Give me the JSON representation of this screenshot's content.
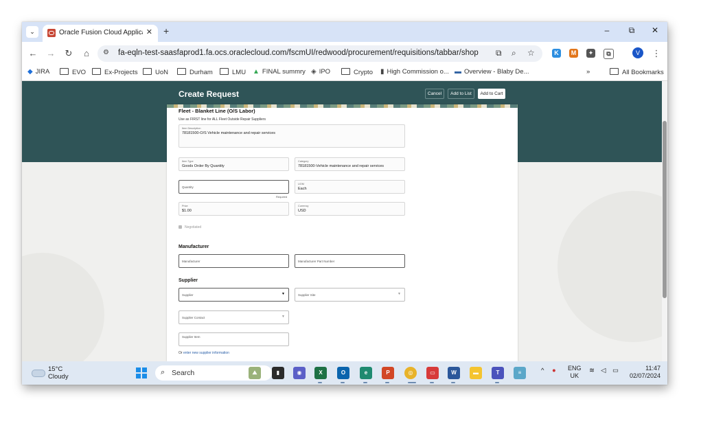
{
  "browser": {
    "tab_title": "Oracle Fusion Cloud Applicatio",
    "url": "fa-eqln-test-saasfaprod1.fa.ocs.oraclecloud.com/fscmUI/redwood/procurement/requisitions/tabbar/shopping/create_...",
    "profile_initial": "V",
    "window_controls": {
      "minimize": "–",
      "restore": "⧉",
      "close": "✕"
    },
    "bookmarks": [
      "JIRA",
      "EVO",
      "Ex-Projects",
      "UoN",
      "Durham",
      "LMU",
      "FINAL summry",
      "IPO",
      "Crypto",
      "High Commission o...",
      "Overview - Blaby De..."
    ],
    "all_bookmarks": "All Bookmarks",
    "more_bookmarks": "»"
  },
  "page": {
    "title": "Create Request",
    "buttons": {
      "cancel": "Cancel",
      "add_to_list": "Add to List",
      "add_to_cart": "Add to Cart"
    },
    "item_title": "Fleet - Blanket Line (O/S Labor)",
    "item_subtitle": "Use as FIRST line for ALL Fleet Outside Repair Suppliers",
    "item_description": {
      "label": "Item Description",
      "value": "78181500-O/S Vehicle maintenance and repair services"
    },
    "item_type": {
      "label": "Item Type",
      "value": "Goods Order By Quantity"
    },
    "category": {
      "label": "Category",
      "value": "78181500-Vehicle maintenance and repair services"
    },
    "quantity": {
      "placeholder": "Quantity",
      "required": "Required"
    },
    "uom": {
      "label": "UOM",
      "value": "Each"
    },
    "price": {
      "label": "Price",
      "value": "$1.00"
    },
    "currency": {
      "label": "Currency",
      "value": "USD"
    },
    "negotiated": "Negotiated",
    "manufacturer_section": "Manufacturer",
    "manufacturer": "Manufacturer",
    "manufacturer_part": "Manufacturer Part Number",
    "supplier_section": "Supplier",
    "supplier": "Supplier",
    "supplier_site": "Supplier Site",
    "supplier_contact": "Supplier Contact",
    "supplier_item": "Supplier Item",
    "supplier_link_prefix": "Or",
    "supplier_link": "enter new supplier information"
  },
  "taskbar": {
    "temperature": "15°C",
    "weather": "Cloudy",
    "search": "Search",
    "lang_top": "ENG",
    "lang_bottom": "UK",
    "time": "11:47",
    "date": "02/07/2024"
  }
}
